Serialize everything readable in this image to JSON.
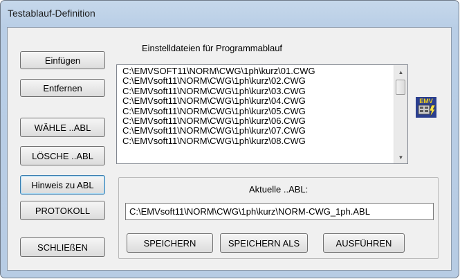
{
  "window": {
    "title": "Testablauf-Definition"
  },
  "buttons": {
    "einfuegen": "Einfügen",
    "entfernen": "Entfernen",
    "waehle_abl": "WÄHLE ..ABL",
    "loesche_abl": "LÖSCHE ..ABL",
    "hinweis_abl": "Hinweis zu ABL",
    "protokoll": "PROTOKOLL",
    "schliessen": "SCHLIEßEN",
    "speichern": "SPEICHERN",
    "speichern_als": "SPEICHERN ALS",
    "ausfuehren": "AUSFÜHREN"
  },
  "list": {
    "label": "Einstelldateien für Programmablauf",
    "items": [
      "C:\\EMVSOFT11\\NORM\\CWG\\1ph\\kurz\\01.CWG",
      "C:\\EMVsoft11\\NORM\\CWG\\1ph\\kurz\\02.CWG",
      "C:\\EMVsoft11\\NORM\\CWG\\1ph\\kurz\\03.CWG",
      "C:\\EMVsoft11\\NORM\\CWG\\1ph\\kurz\\04.CWG",
      "C:\\EMVsoft11\\NORM\\CWG\\1ph\\kurz\\05.CWG",
      "C:\\EMVsoft11\\NORM\\CWG\\1ph\\kurz\\06.CWG",
      "C:\\EMVsoft11\\NORM\\CWG\\1ph\\kurz\\07.CWG",
      "C:\\EMVsoft11\\NORM\\CWG\\1ph\\kurz\\08.CWG"
    ]
  },
  "abl": {
    "label": "Aktuelle ..ABL:",
    "value": "C:\\EMVsoft11\\NORM\\CWG\\1ph\\kurz\\NORM-CWG_1ph.ABL"
  },
  "logo": {
    "text": "EMV",
    "icon": "emv-app-icon",
    "colors": {
      "bg": "#2b3f8f",
      "letters": "#f2d21c",
      "bolt": "#f5e04a"
    }
  }
}
